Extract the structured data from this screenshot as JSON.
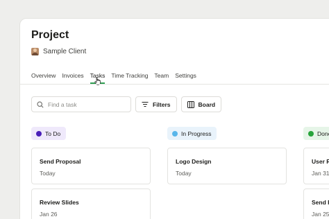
{
  "project": {
    "title": "Project",
    "client": "Sample Client"
  },
  "tabs": [
    {
      "label": "Overview",
      "active": false
    },
    {
      "label": "Invoices",
      "active": false
    },
    {
      "label": "Tasks",
      "active": true
    },
    {
      "label": "Time Tracking",
      "active": false
    },
    {
      "label": "Team",
      "active": false
    },
    {
      "label": "Settings",
      "active": false
    }
  ],
  "toolbar": {
    "search_placeholder": "Find a task",
    "filters_label": "Filters",
    "board_label": "Board"
  },
  "colors": {
    "accent": "#2e9f52",
    "todo_bg": "#efe9fb",
    "todo_dot": "#4a1fb8",
    "progress_bg": "#e9f3fb",
    "progress_dot": "#58b6ea",
    "done_bg": "#e6f5e8",
    "done_dot": "#27a43b"
  },
  "columns": [
    {
      "label": "To Do",
      "cards": [
        {
          "title": "Send Proposal",
          "date": "Today"
        },
        {
          "title": "Review Slides",
          "date": "Jan 26"
        }
      ]
    },
    {
      "label": "In Progress",
      "cards": [
        {
          "title": "Logo Design",
          "date": "Today"
        }
      ]
    },
    {
      "label": "Done",
      "cards": [
        {
          "title": "User Re",
          "date": "Jan 31"
        },
        {
          "title": "Send R",
          "date": "Jan 25"
        }
      ]
    }
  ]
}
